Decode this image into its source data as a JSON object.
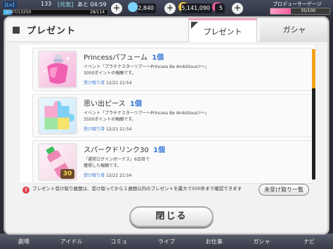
{
  "hud": {
    "level_label": "[Lv]",
    "level_value": "133",
    "genki": "[元気]",
    "timer": "あと 04:59",
    "stamina_current": "1047/13250",
    "stamina_sub": "28/114",
    "stamina_fraction": 0.079,
    "jewels": "2,840",
    "money": "5,141,090",
    "tickets": "5",
    "gauge_label": "プロデューサーゲージ",
    "gauge_text": "35/100",
    "gauge_fraction": 0.35
  },
  "dialog": {
    "title": "プレゼント",
    "tabs": {
      "present": "プレゼント",
      "gacha": "ガシャ"
    },
    "items": [
      {
        "name": "Princessパフューム",
        "qty": "1個",
        "desc_line1": "イベント「プラチナスターツアー～Princess Be Ambitious!!～」",
        "desc_line2": "3000ポイントの報酬です。",
        "date_label": "受け取り済",
        "date": "12/21 21:54",
        "icon": "perfume-icon"
      },
      {
        "name": "思い出ピース",
        "qty": "1個",
        "desc_line1": "イベント「プラチナスターツアー～Princess Be Ambitious!!～」",
        "desc_line2": "3500ポイントの報酬です。",
        "date_label": "受け取り済",
        "date": "12/21 21:54",
        "icon": "puzzle-piece-icon"
      },
      {
        "name": "スパークドリンク30",
        "qty": "1個",
        "desc_line1": "「通常ログインボーナス」6日目で",
        "desc_line2": "獲得した報酬です。",
        "date_label": "受け取り済",
        "date": "12/21 21:54",
        "icon": "drink-icon",
        "badge": "30"
      }
    ],
    "note": "プレゼント受け取り履歴は、受け取ってから１週間以内のプレゼントを最大で500件まで確認できます",
    "unreceived_button": "未受け取り一覧",
    "close_button": "閉じる"
  },
  "nav": [
    "劇場",
    "アイドル",
    "コミュ",
    "ライブ",
    "お仕事",
    "ガシャ",
    "ナビ"
  ]
}
